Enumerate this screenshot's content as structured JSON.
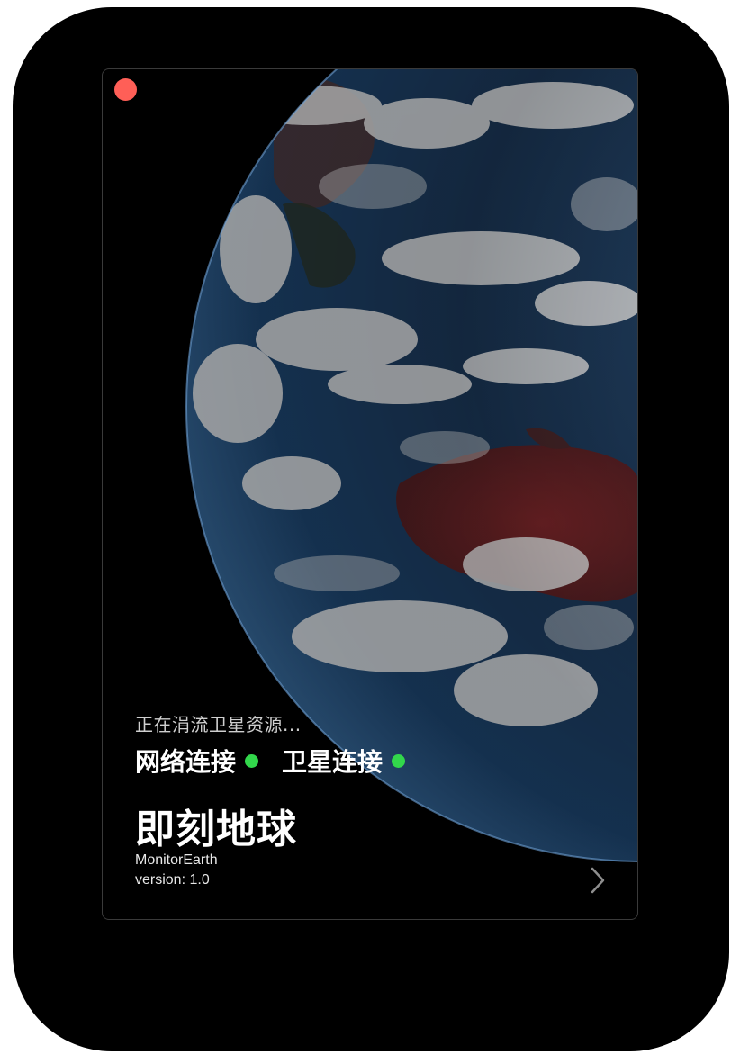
{
  "window": {
    "close_color": "#ff5f57"
  },
  "status": {
    "loading_text": "正在涓流卫星资源..."
  },
  "connections": [
    {
      "label": "网络连接",
      "state": "connected",
      "color": "#32d74b"
    },
    {
      "label": "卫星连接",
      "state": "connected",
      "color": "#32d74b"
    }
  ],
  "app": {
    "title": "即刻地球",
    "name": "MonitorEarth",
    "version_text": "version: 1.0"
  },
  "icons": {
    "close": "close-icon",
    "next": "chevron-right-icon",
    "earth": "earth-image"
  }
}
